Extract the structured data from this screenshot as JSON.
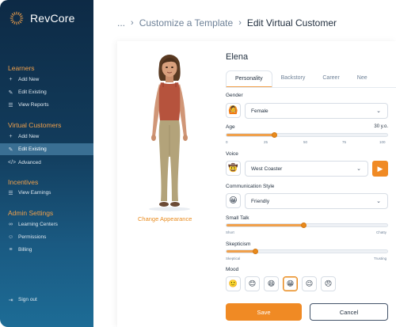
{
  "app": {
    "name": "RevCore"
  },
  "sidebar": {
    "learners": {
      "title": "Learners",
      "items": [
        {
          "label": "Add New",
          "icon": "plus-icon"
        },
        {
          "label": "Edit Existing",
          "icon": "pencil-icon"
        },
        {
          "label": "View Reports",
          "icon": "list-icon"
        }
      ]
    },
    "virtual_customers": {
      "title": "Virtual Customers",
      "items": [
        {
          "label": "Add New",
          "icon": "plus-icon"
        },
        {
          "label": "Edit Existing",
          "icon": "pencil-icon",
          "active": true
        },
        {
          "label": "Advanced",
          "icon": "code-icon"
        }
      ]
    },
    "incentives": {
      "title": "Incentives",
      "items": [
        {
          "label": "View Earnings",
          "icon": "list-icon"
        }
      ]
    },
    "admin": {
      "title": "Admin Settings",
      "items": [
        {
          "label": "Learning Centers",
          "icon": "link-icon"
        },
        {
          "label": "Permissions",
          "icon": "user-check-icon"
        },
        {
          "label": "Billing",
          "icon": "database-icon"
        }
      ]
    },
    "sign_out": {
      "label": "Sign out",
      "icon": "sign-out-icon"
    }
  },
  "breadcrumb": {
    "ellipsis": "...",
    "parent": "Customize a Template",
    "current": "Edit Virtual Customer"
  },
  "customer": {
    "name": "Elena",
    "change_appearance": "Change Appearance"
  },
  "tabs": [
    "Personality",
    "Backstory",
    "Career",
    "Nee"
  ],
  "form": {
    "gender": {
      "label": "Gender",
      "value": "Female",
      "emoji": "🙆"
    },
    "age": {
      "label": "Age",
      "value_text": "30 y.o.",
      "value": 30,
      "ticks": [
        "0",
        "25",
        "50",
        "75",
        "100"
      ]
    },
    "voice": {
      "label": "Voice",
      "value": "West Coaster",
      "emoji": "🤠"
    },
    "communication_style": {
      "label": "Communication Style",
      "value": "Friendly",
      "emoji": "😀"
    },
    "small_talk": {
      "label": "Small Talk",
      "level": 0.48,
      "min_label": "Short",
      "max_label": "Chatty"
    },
    "skepticism": {
      "label": "Skepticism",
      "level": 0.18,
      "min_label": "Skeptical",
      "max_label": "Trusting"
    },
    "mood": {
      "label": "Mood",
      "options": [
        "🙂",
        "😊",
        "😄",
        "😁",
        "😉",
        "😠"
      ],
      "selected_index": 3
    }
  },
  "actions": {
    "save": "Save",
    "cancel": "Cancel"
  },
  "colors": {
    "accent": "#f08a24",
    "sidebar_top": "#0d2a45",
    "sidebar_bottom": "#1d6c96",
    "section_title": "#f0a04b"
  }
}
